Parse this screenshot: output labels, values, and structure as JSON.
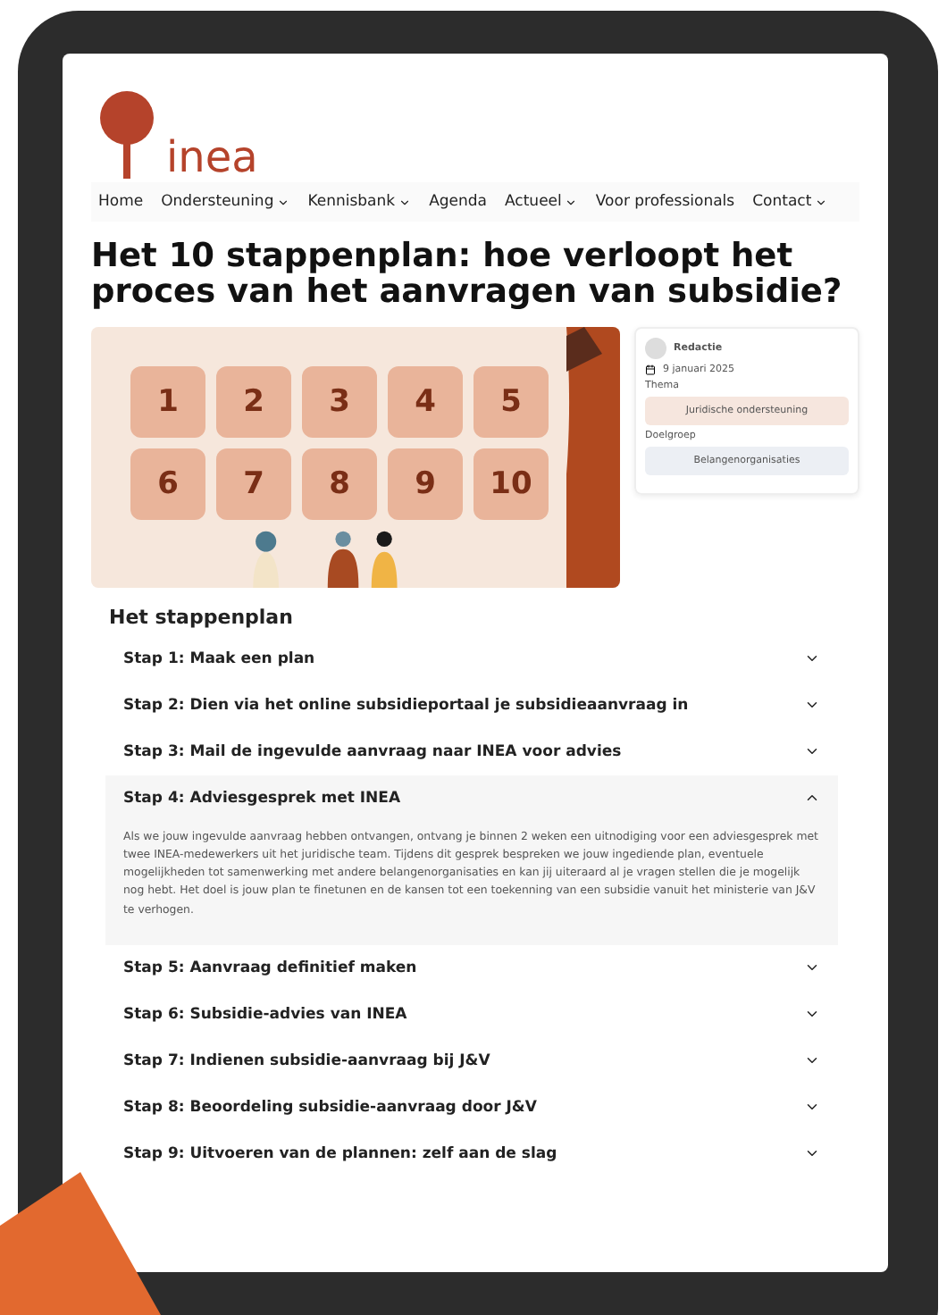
{
  "logo": {
    "text": "inea"
  },
  "nav": [
    {
      "label": "Home",
      "dropdown": false
    },
    {
      "label": "Ondersteuning",
      "dropdown": true
    },
    {
      "label": "Kennisbank",
      "dropdown": true
    },
    {
      "label": "Agenda",
      "dropdown": false
    },
    {
      "label": "Actueel",
      "dropdown": true
    },
    {
      "label": "Voor professionals",
      "dropdown": false
    },
    {
      "label": "Contact",
      "dropdown": true
    }
  ],
  "title": "Het 10 stappenplan: hoe verloopt het proces van het aanvragen van subsidie?",
  "illustration": {
    "tiles": [
      "1",
      "2",
      "3",
      "4",
      "5",
      "6",
      "7",
      "8",
      "9",
      "10"
    ]
  },
  "meta": {
    "author": "Redactie",
    "date": "9 januari 2025",
    "theme_label": "Thema",
    "theme": "Juridische ondersteuning",
    "audience_label": "Doelgroep",
    "audience": "Belangenorganisaties"
  },
  "section_title": "Het stappenplan",
  "steps": [
    {
      "title": "Stap 1: Maak een plan",
      "expanded": false
    },
    {
      "title": "Stap 2: Dien via het online subsidieportaal je subsidieaanvraag in",
      "expanded": false
    },
    {
      "title": "Stap 3: Mail de ingevulde aanvraag naar INEA voor advies",
      "expanded": false
    },
    {
      "title": "Stap 4: Adviesgesprek met INEA",
      "expanded": true,
      "body": "Als we jouw ingevulde aanvraag hebben ontvangen, ontvang je binnen 2 weken een uitnodiging voor een adviesgesprek met twee INEA-medewerkers uit het juridische team. Tijdens dit gesprek bespreken we jouw ingediende plan, eventuele mogelijkheden tot samenwerking met andere belangenorganisaties en kan jij uiteraard al je vragen stellen die je mogelijk nog hebt. Het doel is jouw plan te finetunen en de kansen tot een toekenning van een subsidie vanuit het ministerie van J&V te verhogen."
    },
    {
      "title": "Stap 5: Aanvraag definitief maken",
      "expanded": false
    },
    {
      "title": "Stap 6: Subsidie-advies van INEA",
      "expanded": false
    },
    {
      "title": "Stap 7: Indienen subsidie-aanvraag bij J&V",
      "expanded": false
    },
    {
      "title": "Stap 8: Beoordeling subsidie-aanvraag door J&V",
      "expanded": false
    },
    {
      "title": "Stap 9: Uitvoeren van de plannen: zelf aan de slag",
      "expanded": false
    }
  ]
}
